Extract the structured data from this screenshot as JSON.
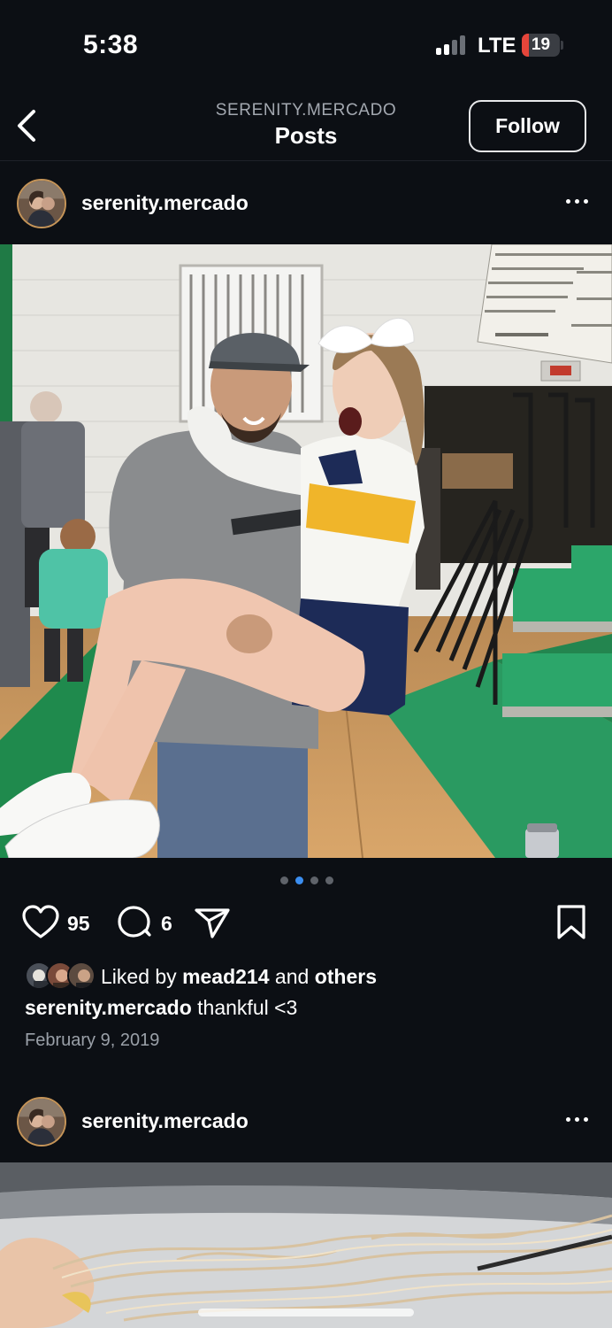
{
  "status_bar": {
    "time": "5:38",
    "network": "LTE",
    "battery_level": "19",
    "battery_fraction": 0.19,
    "battery_color": "#e5453a"
  },
  "nav": {
    "subtitle": "SERENITY.MERCADO",
    "title": "Posts",
    "follow_label": "Follow",
    "back_icon": "chevron-left-icon"
  },
  "post": {
    "username": "serenity.mercado",
    "more_icon": "more-horizontal-icon",
    "carousel": {
      "total": 4,
      "active": 2,
      "active_color": "#3b8ef0"
    },
    "likes": "95",
    "comments": "6",
    "liked_prefix": "Liked by",
    "liked_user": "mead214",
    "liked_and": "and",
    "liked_others": "others",
    "caption_user": "serenity.mercado",
    "caption_text": "thankful <3",
    "date": "February 9, 2019"
  },
  "next_post": {
    "username": "serenity.mercado"
  },
  "theme": {
    "background": "#0c0f14",
    "court_green": "#2e9a62"
  }
}
